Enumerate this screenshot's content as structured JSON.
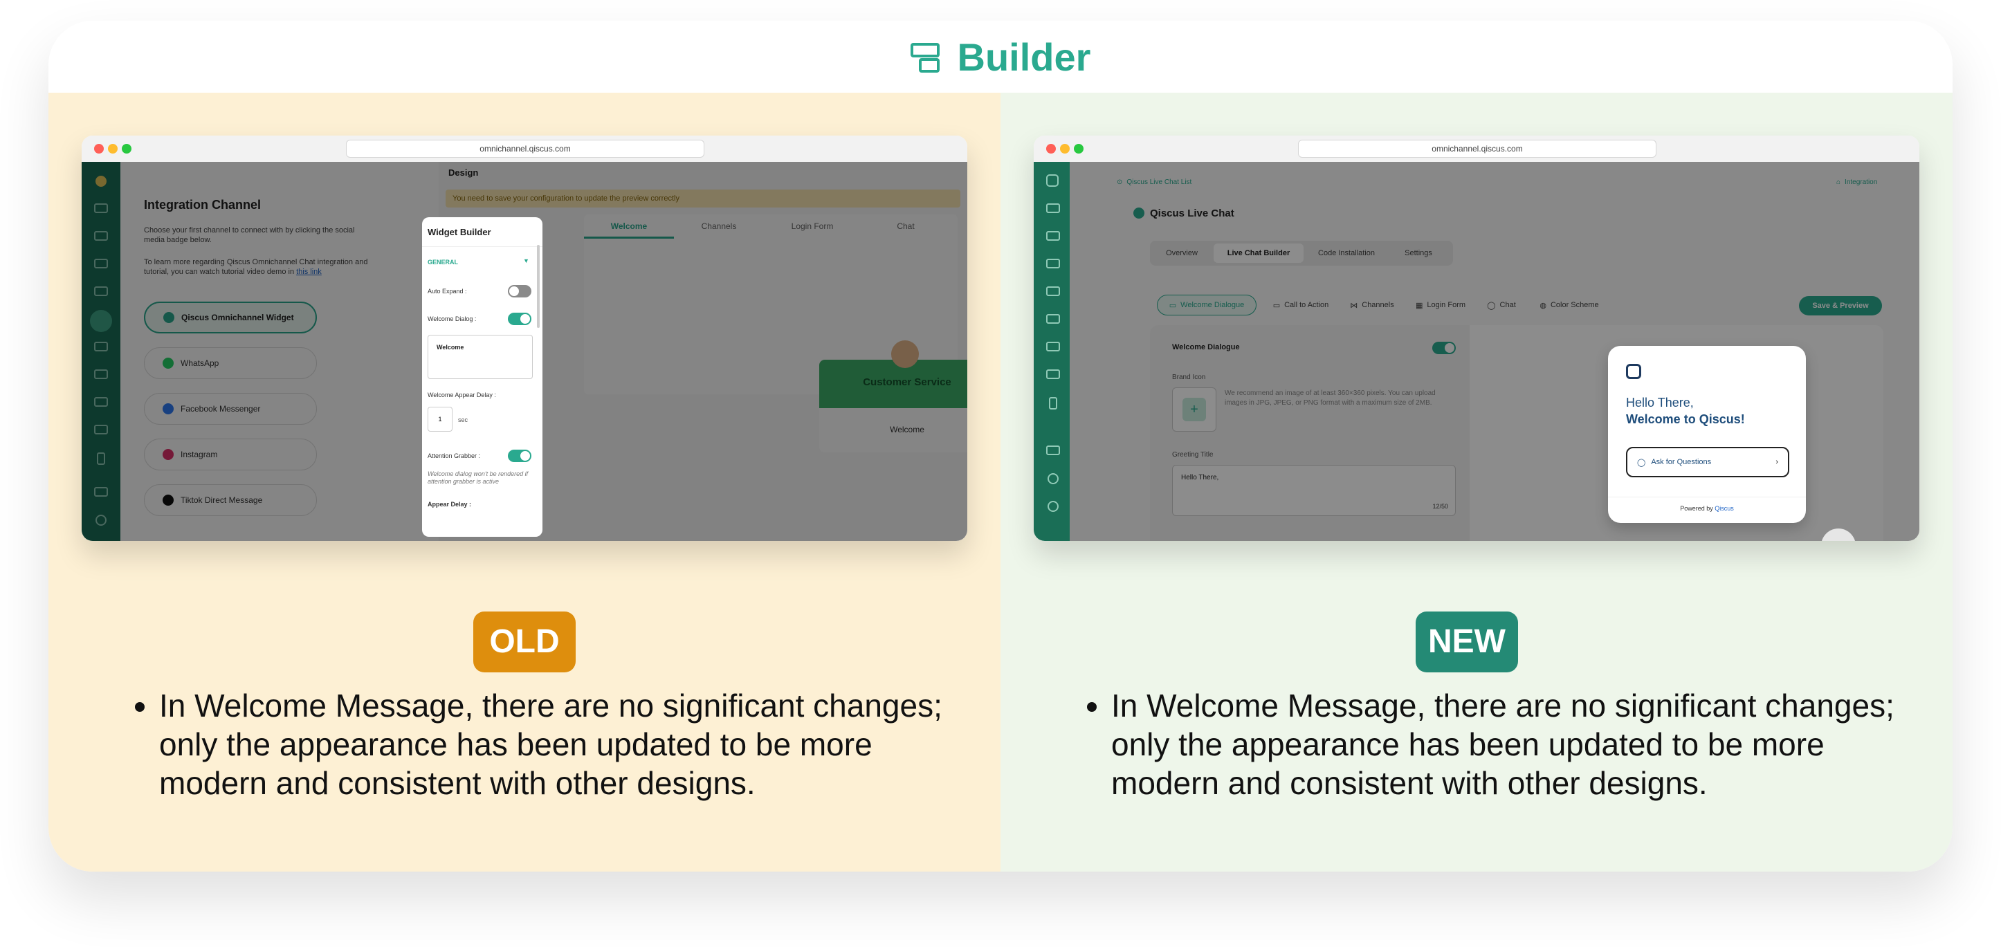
{
  "header": {
    "title": "Builder",
    "icon": "layout-builder-icon"
  },
  "old": {
    "badge": "OLD",
    "url": "omnichannel.qiscus.com",
    "note": "In Welcome Message, there are no significant changes; only the appearance has been updated to be more modern and consistent with other designs.",
    "integration": {
      "title": "Integration Channel",
      "desc1": "Choose your first channel to connect with by clicking the social media badge below.",
      "desc2": "To learn more regarding Qiscus Omnichannel Chat integration and tutorial, you can watch tutorial video demo in",
      "link": "this link",
      "channels": [
        "Qiscus Omnichannel Widget",
        "WhatsApp",
        "Facebook Messenger",
        "Instagram",
        "Tiktok Direct Message"
      ]
    },
    "design": {
      "title": "Design",
      "warning": "You need to save your configuration to update the preview correctly",
      "tabs": [
        "Welcome",
        "Channels",
        "Login Form",
        "Chat"
      ]
    },
    "widget_builder": {
      "title": "Widget Builder",
      "section": "GENERAL",
      "auto_expand": "Auto Expand :",
      "welcome_dialog": "Welcome Dialog :",
      "welcome_text": "Welcome",
      "appear_delay_label": "Welcome Appear Delay :",
      "appear_delay_value": "1",
      "appear_delay_unit": "sec",
      "attention_grabber": "Attention Grabber :",
      "attention_note": "Welcome dialog won't be rendered if attention grabber is active",
      "appear_delay": "Appear Delay :"
    },
    "preview": {
      "title": "Customer Service",
      "message": "Welcome"
    }
  },
  "new": {
    "badge": "NEW",
    "url": "omnichannel.qiscus.com",
    "note": "In Welcome Message, there are no significant changes; only the appearance has been updated to be more modern and consistent with other designs.",
    "breadcrumb": "Qiscus Live Chat List",
    "integration_link": "Integration",
    "page_title": "Qiscus Live Chat",
    "tabs": [
      "Overview",
      "Live Chat Builder",
      "Code Installation",
      "Settings"
    ],
    "builder_tabs": [
      "Welcome Dialogue",
      "Call to Action",
      "Channels",
      "Login Form",
      "Chat",
      "Color Scheme"
    ],
    "save_button": "Save & Preview",
    "form": {
      "welcome_dialogue": "Welcome Dialogue",
      "brand_icon": "Brand Icon",
      "brand_icon_help": "We recommend an image of at least 360×360 pixels. You can upload images in JPG, JPEG, or PNG format with a maximum size of 2MB.",
      "greeting_title": "Greeting Title",
      "greeting_value": "Hello There,",
      "greeting_count": "12/50"
    },
    "preview": {
      "hello": "Hello There,",
      "welcome": "Welcome to Qiscus!",
      "ask": "Ask for Questions",
      "powered_by": "Powered by",
      "brand": "Qiscus"
    }
  },
  "colors": {
    "accent": "#2aa98f",
    "old_badge": "#de8e0d",
    "new_badge": "#248a75",
    "old_bg": "#fdf0d4",
    "new_bg": "#eef6ea"
  }
}
